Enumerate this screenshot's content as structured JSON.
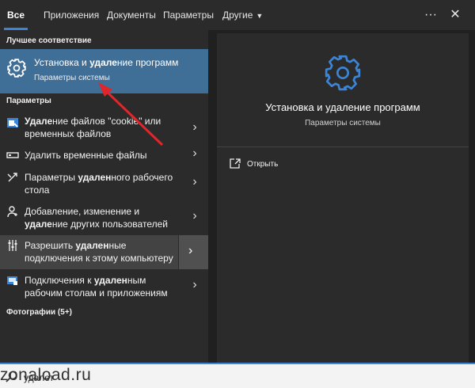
{
  "tabs": [
    {
      "label": "Все",
      "active": true
    },
    {
      "label": "Приложения"
    },
    {
      "label": "Документы"
    },
    {
      "label": "Параметры"
    },
    {
      "label": "Другие"
    }
  ],
  "topbar_icons": [
    "more-icon",
    "close-icon"
  ],
  "best_match": {
    "section_label": "Лучшее соответствие",
    "title_pre": "Установка и ",
    "title_bold": "удале",
    "title_post": "ние программ",
    "subtitle": "Параметры системы",
    "icon": "gear-icon"
  },
  "settings": {
    "section_label": "Параметры",
    "items": [
      {
        "pre": "",
        "bold": "Удале",
        "post": "ние файлов \"cookie\" или временных файлов",
        "icon": "browser-settings-icon"
      },
      {
        "pre": "",
        "bold": "",
        "post": "Удалить временные файлы",
        "icon": "storage-icon"
      },
      {
        "pre": "Параметры ",
        "bold": "удален",
        "post": "ного рабочего стола",
        "icon": "remote-desktop-settings-icon"
      },
      {
        "pre": "Добавление, изменение и ",
        "bold": "удале",
        "post": "ние других пользователей",
        "icon": "user-icon"
      },
      {
        "pre": "Разрешить ",
        "bold": "удален",
        "post": "ные подключения к этому компьютеру",
        "icon": "sliders-icon"
      },
      {
        "pre": "Подключения к ",
        "bold": "удален",
        "post": "ным рабочим столам и приложениям",
        "icon": "remote-connection-icon"
      }
    ]
  },
  "photos": {
    "section_label": "Фотографии (5+)"
  },
  "preview": {
    "title": "Установка и удаление программ",
    "subtitle": "Параметры системы",
    "icon": "gear-icon",
    "open_label": "Открыть",
    "open_icon": "open-icon"
  },
  "search": {
    "value": "удалет",
    "icon": "search-icon"
  },
  "watermark": "zonaload.ru",
  "colors": {
    "accent": "#3c84d6",
    "selection": "#3f6e97",
    "annotation_arrow": "#e0262b"
  }
}
